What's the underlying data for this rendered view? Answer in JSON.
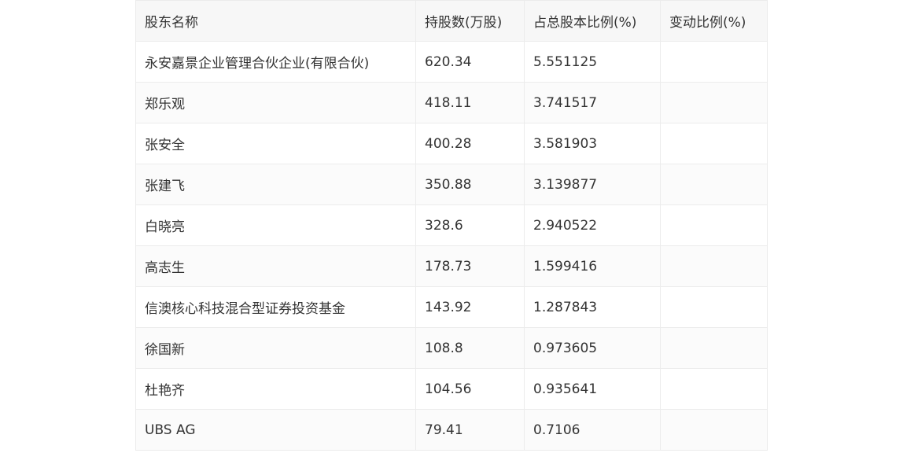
{
  "table": {
    "headers": [
      "股东名称",
      "持股数(万股)",
      "占总股本比例(%)",
      "变动比例(%)"
    ],
    "rows": [
      [
        "永安嘉景企业管理合伙企业(有限合伙)",
        "620.34",
        "5.551125",
        ""
      ],
      [
        "郑乐观",
        "418.11",
        "3.741517",
        ""
      ],
      [
        "张安全",
        "400.28",
        "3.581903",
        ""
      ],
      [
        "张建飞",
        "350.88",
        "3.139877",
        ""
      ],
      [
        "白晓亮",
        "328.6",
        "2.940522",
        ""
      ],
      [
        "高志生",
        "178.73",
        "1.599416",
        ""
      ],
      [
        "信澳核心科技混合型证券投资基金",
        "143.92",
        "1.287843",
        ""
      ],
      [
        "徐国新",
        "108.8",
        "0.973605",
        ""
      ],
      [
        "杜艳齐",
        "104.56",
        "0.935641",
        ""
      ],
      [
        "UBS AG",
        "79.41",
        "0.7106",
        ""
      ]
    ]
  }
}
